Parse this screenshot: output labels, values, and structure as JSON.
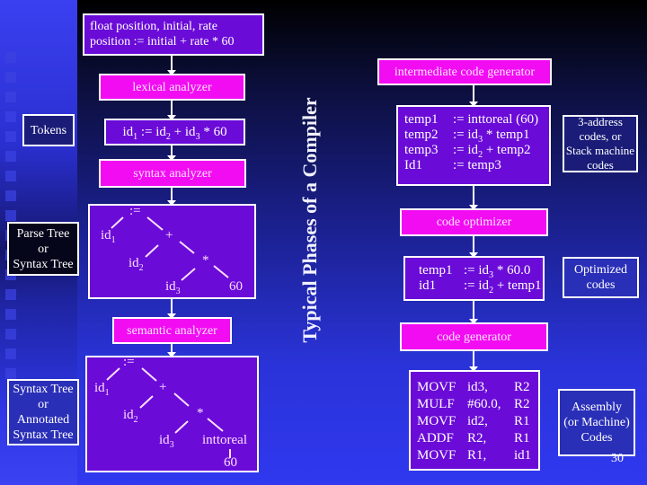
{
  "slide_title": "Typical Phases of a Compiler",
  "page_number": "30",
  "colors": {
    "phase_box": "#f20cf2",
    "content_box": "#6a0bd8",
    "annotation_box": "#1a1c78",
    "background_top": "#000000",
    "background_bottom": "#3038f0"
  },
  "source": {
    "line1": "float position, initial, rate",
    "line2": "position := initial + rate * 60"
  },
  "phases": {
    "lexical": "lexical analyzer",
    "syntax": "syntax analyzer",
    "semantic": "semantic analyzer",
    "intermediate": "intermediate code generator",
    "optimizer": "code optimizer",
    "generator": "code generator"
  },
  "tokens": {
    "id1": "id",
    "sub1": "1",
    "assign": " := ",
    "id2": "id",
    "sub2": "2",
    "plus": " + ",
    "id3": "id",
    "sub3": "3",
    "times_sixty": " * 60"
  },
  "annotations": {
    "tokens": "Tokens",
    "parse_tree": [
      "Parse Tree",
      "or",
      "Syntax Tree"
    ],
    "annotated_tree": [
      "Syntax Tree",
      "or",
      "Annotated",
      "Syntax Tree"
    ],
    "three_address": [
      "3-address",
      "codes, or",
      "Stack machine",
      "codes"
    ],
    "optimized": [
      "Optimized",
      "codes"
    ],
    "assembly": [
      "Assembly",
      "(or Machine)",
      "Codes"
    ]
  },
  "parse_tree": {
    "root": ":=",
    "id1": "id",
    "id1_sub": "1",
    "plus": "+",
    "id2": "id",
    "id2_sub": "2",
    "times": "*",
    "id3": "id",
    "id3_sub": "3",
    "sixty": "60"
  },
  "annotated_tree": {
    "root": ":=",
    "id1": "id",
    "id1_sub": "1",
    "plus": "+",
    "id2": "id",
    "id2_sub": "2",
    "times": "*",
    "id3": "id",
    "id3_sub": "3",
    "convert": "inttoreal",
    "sixty": "60"
  },
  "intermediate_code": [
    {
      "lhs": "temp1",
      "op": " := ",
      "rhs_a": "inttoreal (60)",
      "sub": "",
      "rhs_b": ""
    },
    {
      "lhs": "temp2",
      "op": "  := ",
      "rhs_a": "id",
      "sub": "3",
      "rhs_b": " * temp1"
    },
    {
      "lhs": "temp3",
      "op": "  := ",
      "rhs_a": "id",
      "sub": "2",
      "rhs_b": " + temp2"
    },
    {
      "lhs": "Id1",
      "op": "      := ",
      "rhs_a": "temp3",
      "sub": "",
      "rhs_b": ""
    }
  ],
  "optimized_code": [
    {
      "lhs": "temp1",
      "op": " := ",
      "rhs_a": "id",
      "sub": "3",
      "rhs_b": " * 60.0"
    },
    {
      "lhs": "id1",
      "op": "      := ",
      "rhs_a": "id",
      "sub": "2",
      "rhs_b": " + temp1"
    }
  ],
  "assembly_code": [
    {
      "op": "MOVF",
      "arg1": "id3,",
      "arg2": "R2"
    },
    {
      "op": "MULF",
      "arg1": "#60.0,",
      "arg2": "R2"
    },
    {
      "op": "MOVF",
      "arg1": "id2,",
      "arg2": "R1"
    },
    {
      "op": "ADDF",
      "arg1": "R2,",
      "arg2": "R1"
    },
    {
      "op": "MOVF",
      "arg1": "R1,",
      "arg2": "id1"
    }
  ]
}
